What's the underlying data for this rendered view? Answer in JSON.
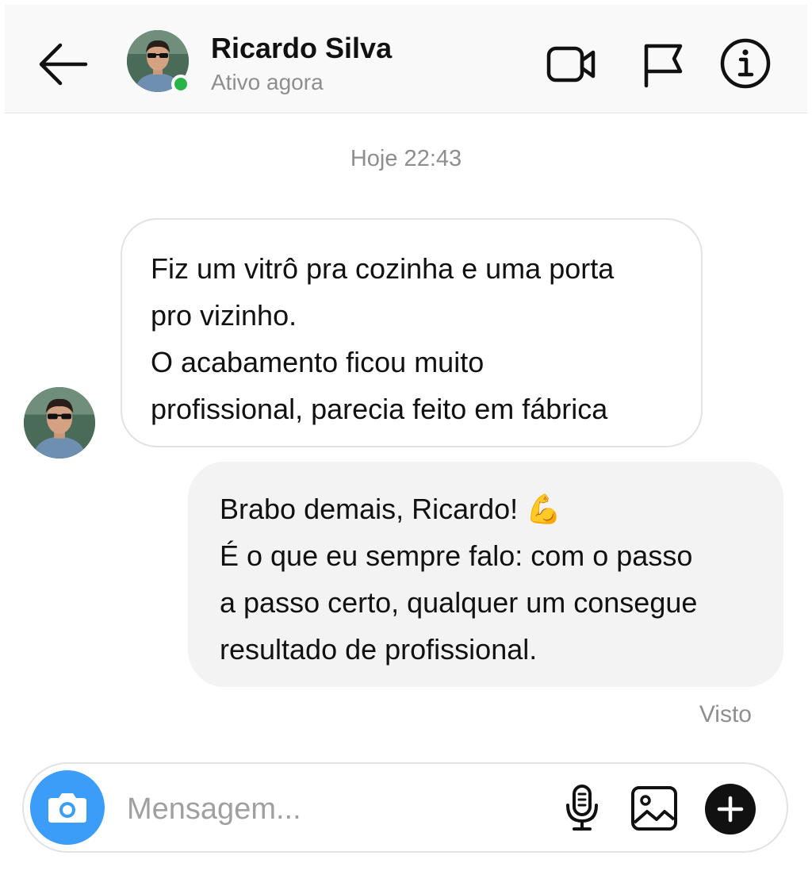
{
  "header": {
    "contact_name": "Ricardo Silva",
    "status": "Ativo agora",
    "online_color": "#28b446",
    "icons": [
      "back-arrow-icon",
      "video-call-icon",
      "flag-icon",
      "info-icon"
    ]
  },
  "conversation": {
    "timestamp": "Hoje 22:43",
    "messages": [
      {
        "direction": "incoming",
        "lines": [
          "Fiz um vitrô pra cozinha e uma porta",
          "pro vizinho.",
          "O acabamento  ficou muito",
          "profissional, parecia feito em fábrica"
        ]
      },
      {
        "direction": "outgoing",
        "lines": [
          "Brabo demais, Ricardo! 💪",
          "É o que eu sempre falo: com o passo",
          "a passo certo, qualquer um consegue",
          "resultado de profissional."
        ]
      }
    ],
    "seen_label": "Visto"
  },
  "composer": {
    "placeholder": "Mensagem...",
    "value": "",
    "accent": "#3b9df8",
    "icons": [
      "camera-icon",
      "microphone-icon",
      "gallery-icon",
      "plus-icon"
    ]
  }
}
